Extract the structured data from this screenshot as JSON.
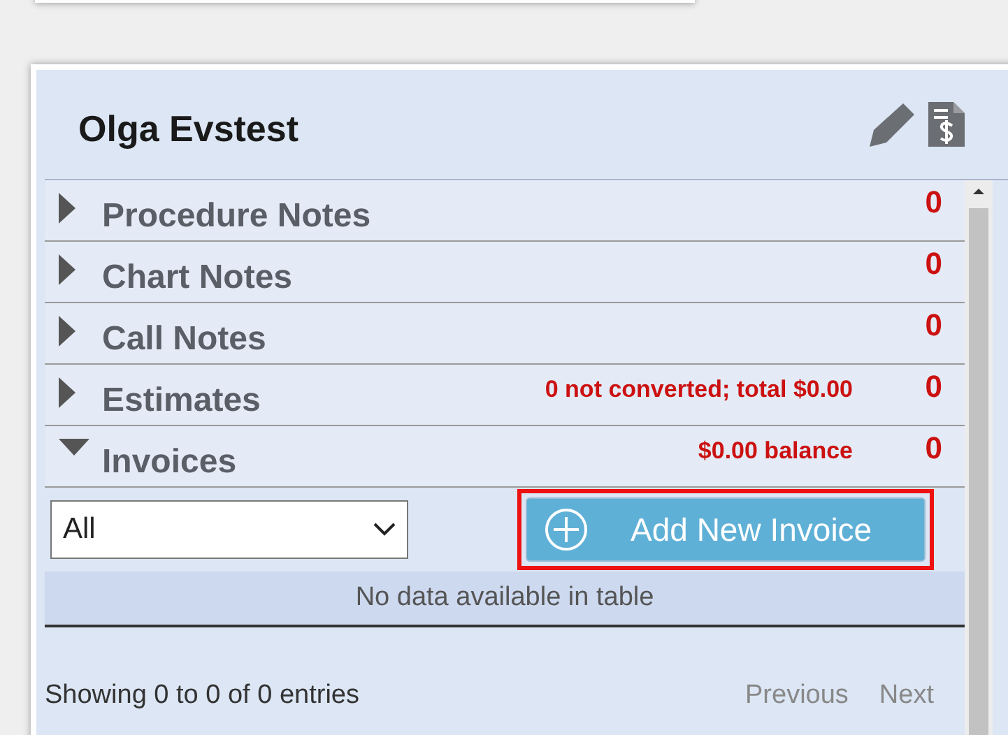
{
  "patient": {
    "name": "Olga Evstest"
  },
  "sections": [
    {
      "label": "Procedure Notes",
      "expanded": false,
      "count": "0"
    },
    {
      "label": "Chart Notes",
      "expanded": false,
      "count": "0"
    },
    {
      "label": "Call Notes",
      "expanded": false,
      "count": "0"
    },
    {
      "label": "Estimates",
      "expanded": false,
      "note": "0 not converted; total $0.00",
      "count": "0"
    },
    {
      "label": "Invoices",
      "expanded": true,
      "note": "$0.00 balance",
      "count": "0"
    }
  ],
  "invoices": {
    "filter": {
      "value": "All"
    },
    "add_button": "Add New Invoice",
    "empty_message": "No data available in table",
    "info": "Showing 0 to 0 of 0 entries",
    "pagination": [
      {
        "label": "Previous",
        "disabled": true
      },
      {
        "label": "Next",
        "disabled": true
      }
    ]
  }
}
